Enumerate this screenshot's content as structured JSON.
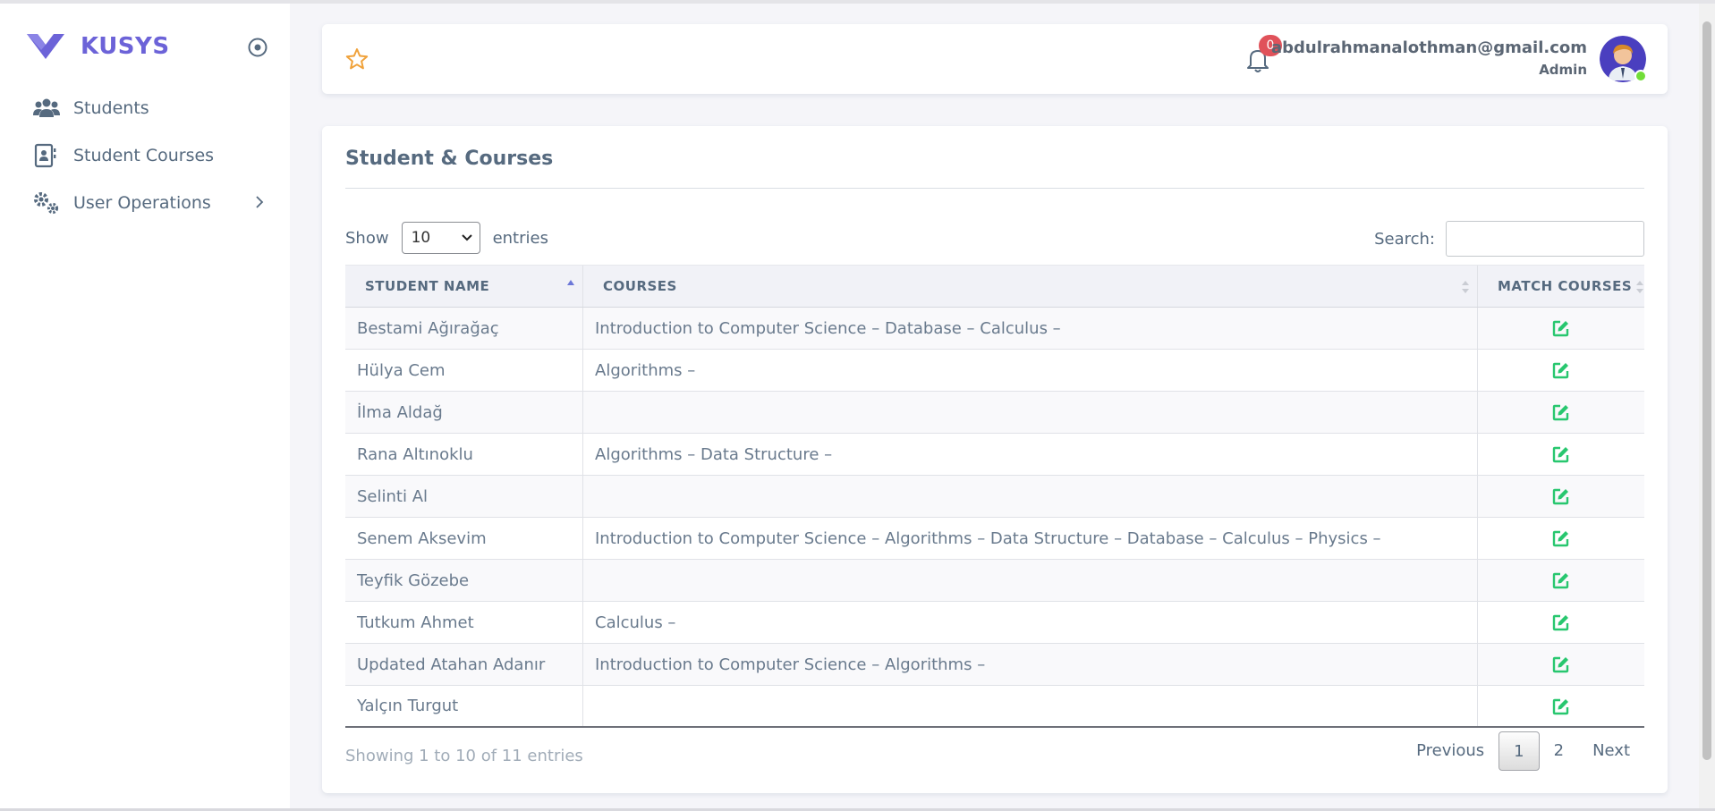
{
  "brand": {
    "name": "KUSYS"
  },
  "sidebar": {
    "items": [
      {
        "label": "Students",
        "icon": "users-icon"
      },
      {
        "label": "Student Courses",
        "icon": "contact-card-icon"
      },
      {
        "label": "User Operations",
        "icon": "gears-icon",
        "has_submenu": true
      }
    ]
  },
  "navbar": {
    "notifications_count": "0",
    "user_email": "abdulrahmanalothman@gmail.com",
    "user_role": "Admin"
  },
  "page": {
    "title": "Student & Courses",
    "show_label": "Show",
    "entries_value": "10",
    "entries_label": "entries",
    "search_label": "Search:",
    "search_value": ""
  },
  "table": {
    "columns": [
      "STUDENT NAME",
      "COURSES",
      "MATCH COURSES"
    ],
    "rows": [
      {
        "name": "Bestami Ağırağaç",
        "courses": "Introduction to Computer Science – Database – Calculus –"
      },
      {
        "name": "Hülya Cem",
        "courses": "Algorithms –"
      },
      {
        "name": "İlma Aldağ",
        "courses": ""
      },
      {
        "name": "Rana Altınoklu",
        "courses": "Algorithms – Data Structure –"
      },
      {
        "name": "Selinti Al",
        "courses": ""
      },
      {
        "name": "Senem Aksevim",
        "courses": "Introduction to Computer Science – Algorithms – Data Structure – Database – Calculus – Physics –"
      },
      {
        "name": "Teyfik Gözebe",
        "courses": ""
      },
      {
        "name": "Tutkum Ahmet",
        "courses": "Calculus –"
      },
      {
        "name": "Updated Atahan Adanır",
        "courses": "Introduction to Computer Science – Algorithms –"
      },
      {
        "name": "Yalçın Turgut",
        "courses": ""
      }
    ]
  },
  "footer": {
    "info": "Showing 1 to 10 of 11 entries",
    "previous": "Previous",
    "pages": [
      "1",
      "2"
    ],
    "current_page": "1",
    "next": "Next"
  },
  "colors": {
    "brand": "#6c63d8",
    "star": "#f0a23b",
    "edit": "#28c76f",
    "badge": "#e0525a"
  }
}
